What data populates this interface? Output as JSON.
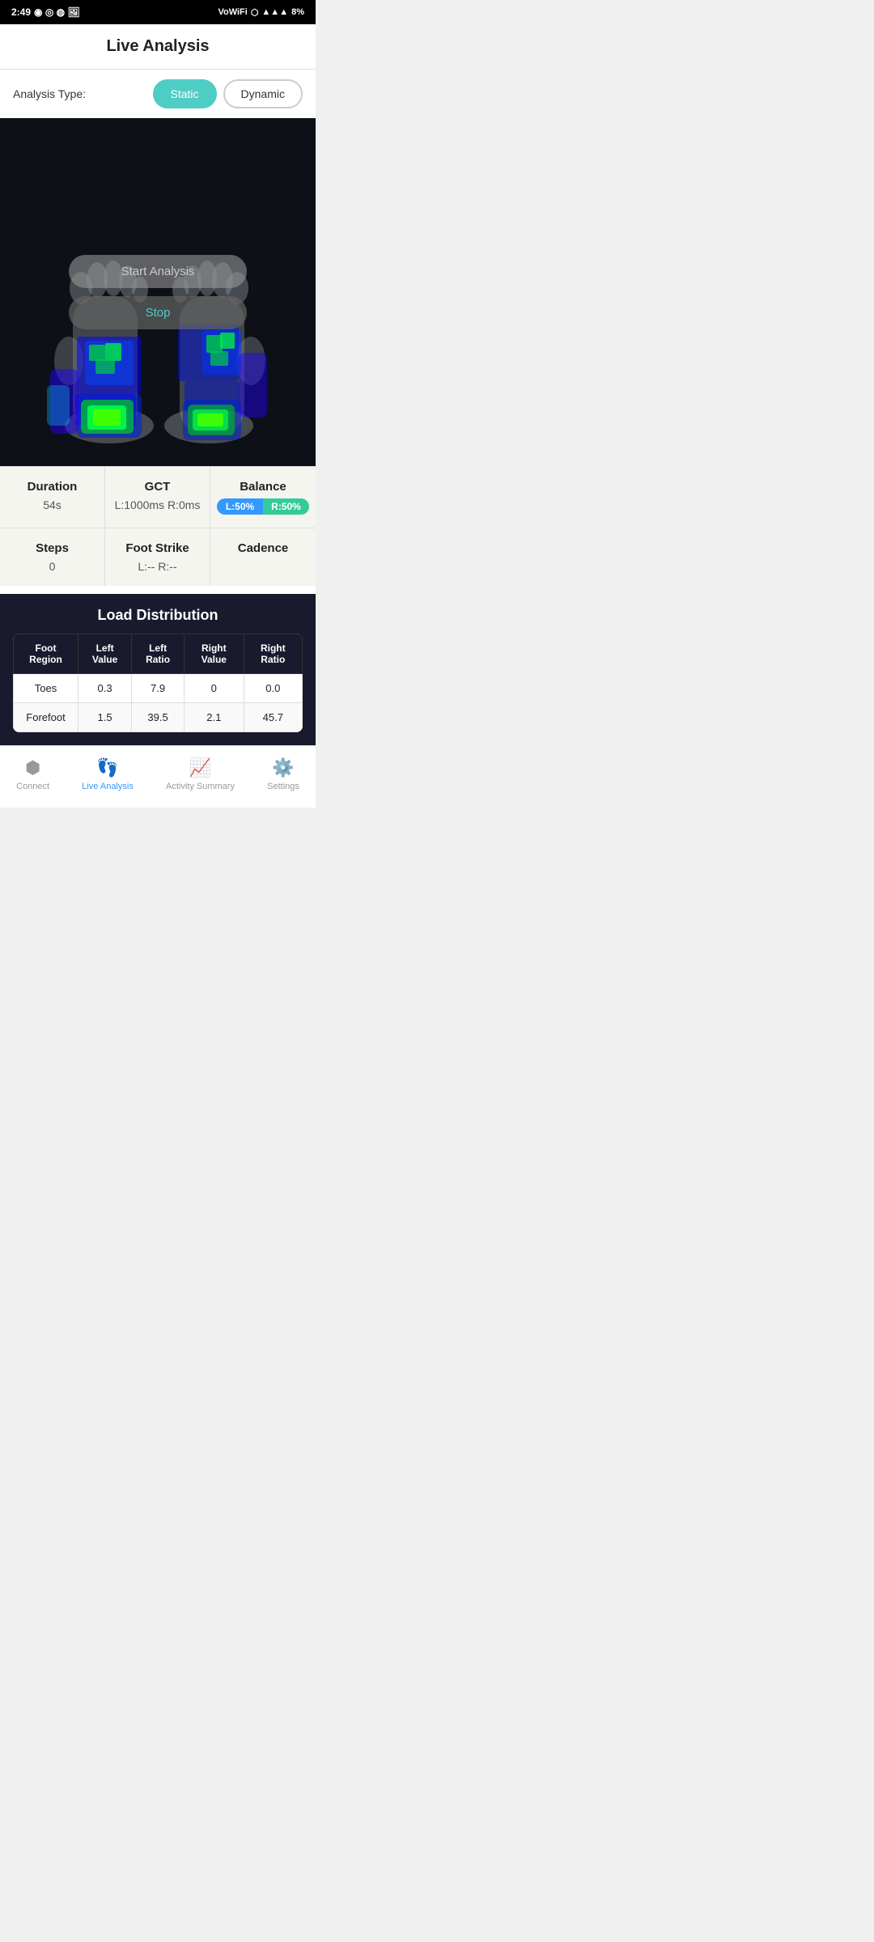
{
  "statusBar": {
    "time": "2:49",
    "battery": "8%",
    "signal": "Vο WiFi"
  },
  "header": {
    "title": "Live Analysis"
  },
  "analysisType": {
    "label": "Analysis Type:",
    "options": [
      "Static",
      "Dynamic"
    ],
    "active": "Static"
  },
  "controls": {
    "startLabel": "Start Analysis",
    "stopLabel": "Stop"
  },
  "metrics": {
    "duration": {
      "title": "Duration",
      "value": "54s"
    },
    "gct": {
      "title": "GCT",
      "value": "L:1000ms R:0ms"
    },
    "balance": {
      "title": "Balance",
      "left": "L:50%",
      "right": "R:50%"
    },
    "steps": {
      "title": "Steps",
      "value": "0"
    },
    "footStrike": {
      "title": "Foot Strike",
      "value": "L:-- R:--"
    },
    "cadence": {
      "title": "Cadence",
      "value": ""
    }
  },
  "loadDistribution": {
    "title": "Load Distribution",
    "columns": [
      "Foot Region",
      "Left Value",
      "Left Ratio",
      "Right Value",
      "Right Ratio"
    ],
    "rows": [
      [
        "Toes",
        "0.3",
        "7.9",
        "0",
        "0.0"
      ],
      [
        "Forefoot",
        "1.5",
        "39.5",
        "2.1",
        "45.7"
      ]
    ]
  },
  "bottomNav": {
    "items": [
      {
        "label": "Connect",
        "icon": "bluetooth",
        "active": false
      },
      {
        "label": "Live Analysis",
        "icon": "footprints",
        "active": true
      },
      {
        "label": "Activity Summary",
        "icon": "chart",
        "active": false
      },
      {
        "label": "Settings",
        "icon": "gear",
        "active": false
      }
    ]
  }
}
